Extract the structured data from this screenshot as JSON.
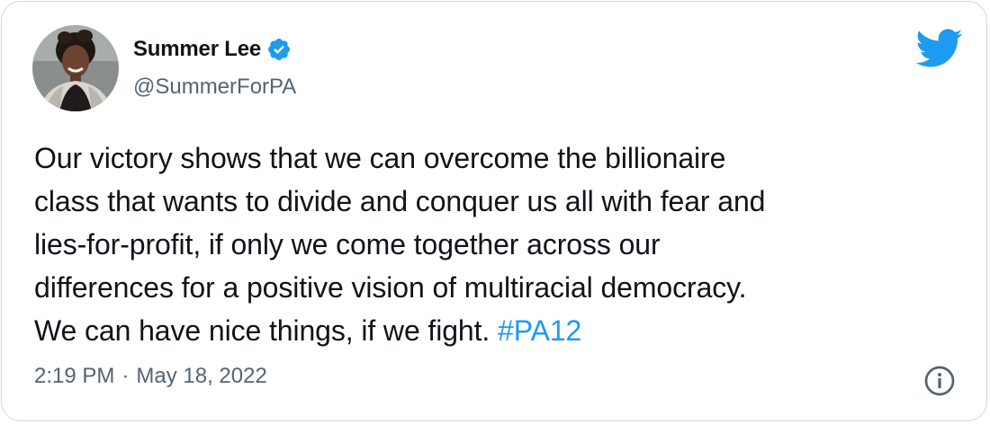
{
  "author": {
    "display_name": "Summer Lee",
    "handle": "@SummerForPA",
    "verified": true,
    "verified_icon": "verified-badge-icon"
  },
  "tweet": {
    "lines": [
      "Our victory shows that we can overcome the billionaire",
      "class that wants to divide and conquer us all with fear and",
      "lies-for-profit, if only we come together across our",
      "differences for a positive vision of multiracial democracy.",
      "We can have nice things, if we fight."
    ],
    "hashtag": "#PA12",
    "time": "2:19 PM",
    "separator": "·",
    "date": "May 18, 2022"
  },
  "icons": {
    "brand": "twitter-bird-icon",
    "info": "info-icon"
  },
  "colors": {
    "accent": "#1d9bf0",
    "text": "#0f1419",
    "secondary": "#536471",
    "border": "#cfd9de"
  }
}
